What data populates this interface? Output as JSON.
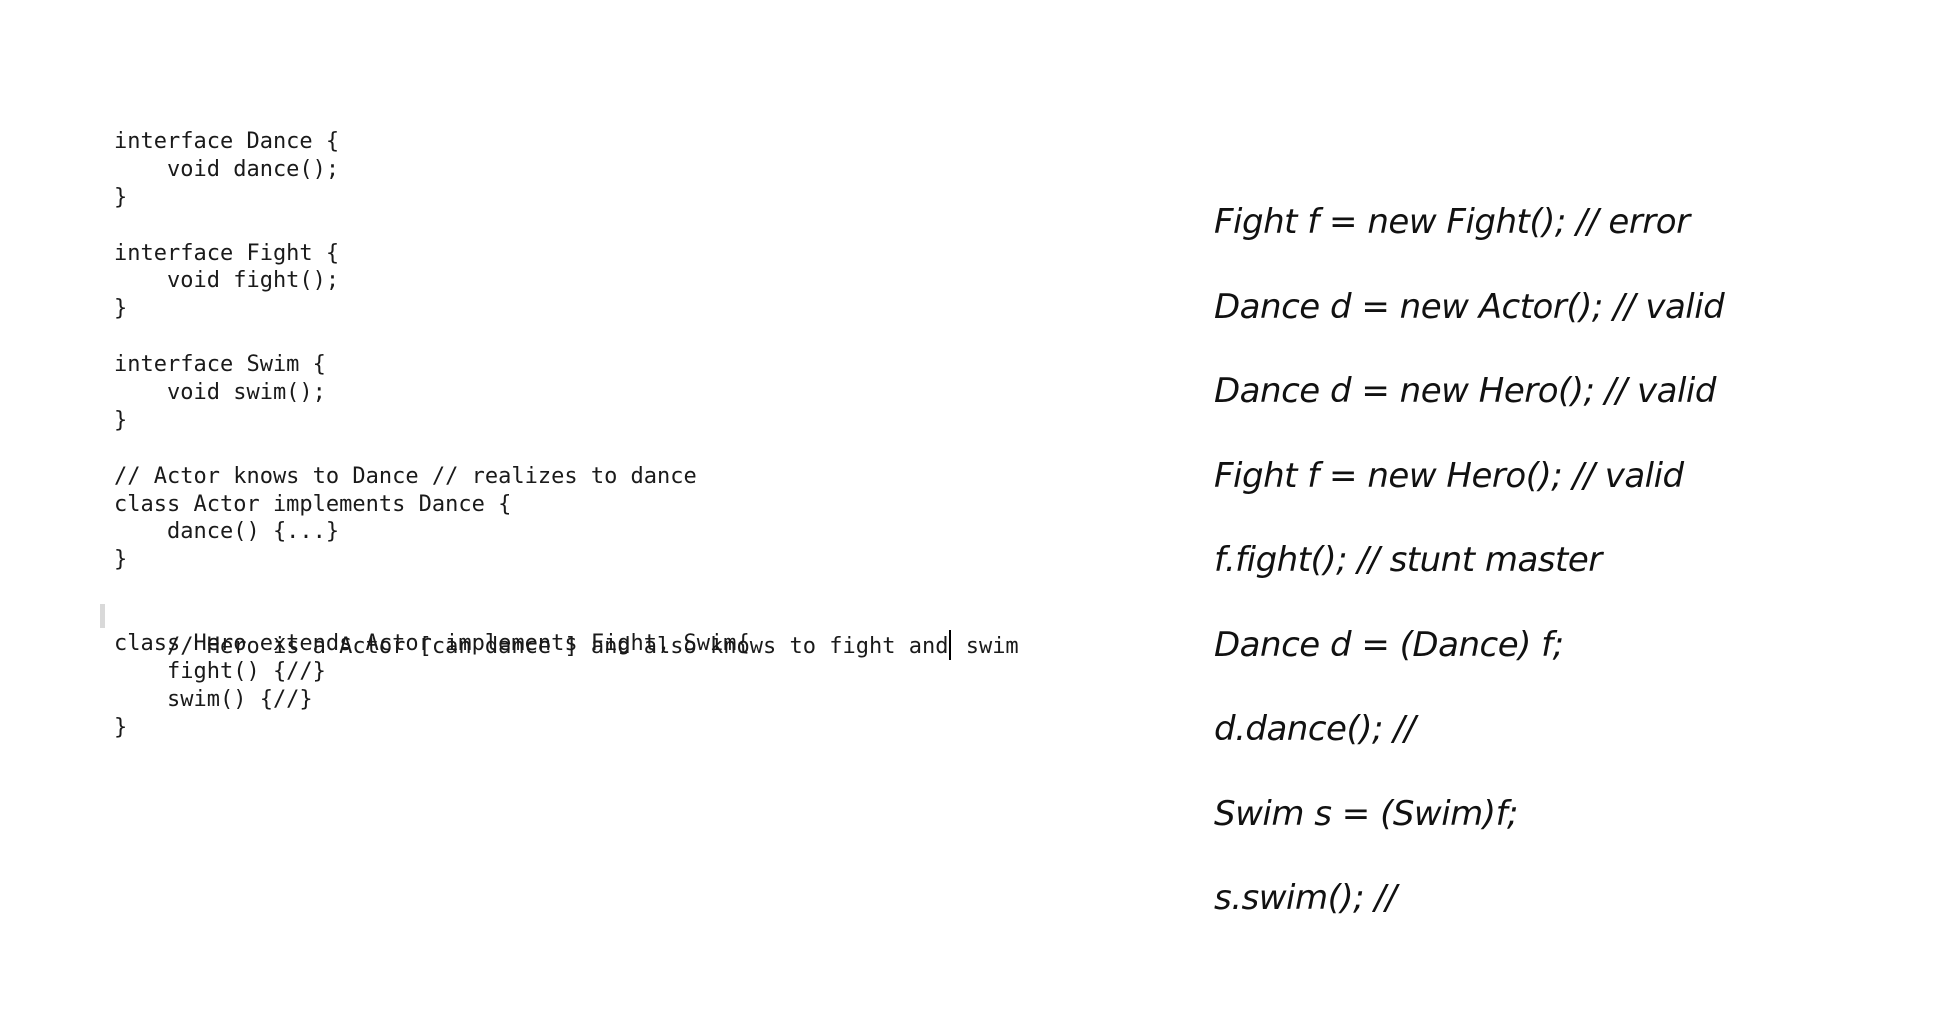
{
  "code": {
    "lines": [
      "interface Dance {",
      "    void dance();",
      "}",
      "",
      "interface Fight {",
      "    void fight();",
      "}",
      "",
      "interface Swim {",
      "    void swim();",
      "}",
      "",
      "// Actor knows to Dance // realizes to dance",
      "class Actor implements Dance {",
      "    dance() {...}",
      "}",
      "",
      "// Hero is a Actor [can dance ] and also knows to fight and",
      "class Hero extends Actor implements Fight, Swim{",
      "    fight() {//}",
      "    swim() {//}",
      "}"
    ],
    "caret_line_tail": " swim"
  },
  "notes": {
    "lines": [
      "Fight f = new Fight(); // error",
      "Dance d = new Actor(); // valid",
      "Dance d = new Hero(); // valid",
      "Fight f = new Hero(); // valid",
      "f.fight(); // stunt master",
      "Dance d = (Dance) f;",
      "d.dance(); //",
      "Swim s = (Swim)f;",
      "s.swim(); //"
    ]
  }
}
